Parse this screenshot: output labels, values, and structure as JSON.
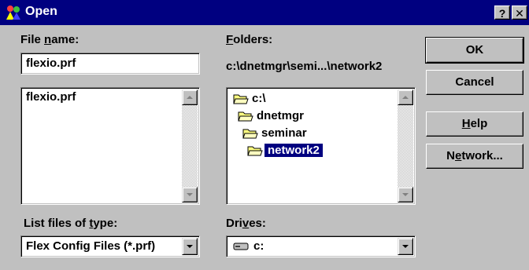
{
  "window": {
    "title": "Open",
    "help_label": "?",
    "close_label": "✕"
  },
  "file_name": {
    "label_pre": "File ",
    "label_key": "n",
    "label_post": "ame:",
    "value": "flexio.prf"
  },
  "files": {
    "items": [
      "flexio.prf"
    ]
  },
  "folders": {
    "label_key": "F",
    "label_post": "olders:",
    "path": "c:\\dnetmgr\\semi...\\network2",
    "items": [
      "c:\\",
      "dnetmgr",
      "seminar",
      "network2"
    ],
    "selected": "network2"
  },
  "file_type": {
    "label_pre": "List files of ",
    "label_key": "t",
    "label_post": "ype:",
    "value": "Flex Config Files (*.prf)"
  },
  "drives": {
    "label_pre": "Dri",
    "label_key": "v",
    "label_post": "es:",
    "value": "c:"
  },
  "buttons": {
    "ok": "OK",
    "cancel": "Cancel",
    "help_key": "H",
    "help_rest": "elp",
    "network_pre": "N",
    "network_key": "e",
    "network_post": "twork..."
  },
  "colors": {
    "title_bar": "#000080",
    "selection": "#000080",
    "face": "#c0c0c0",
    "folder": "#ffff80"
  }
}
